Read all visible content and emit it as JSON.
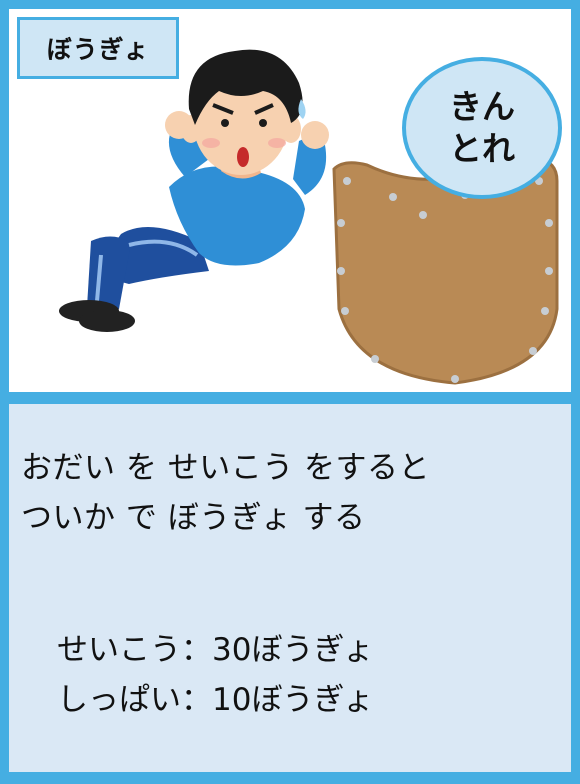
{
  "card": {
    "category_label": "ぼうぎょ",
    "skill_line1": "きん",
    "skill_line2": "とれ",
    "description_line1": "おだい を せいこう をすると",
    "description_line2": "ついか で ぼうぎょ する",
    "success_line": "せいこう：30ぼうぎょ",
    "failure_line": "しっぱい：10ぼうぎょ"
  },
  "colors": {
    "frame": "#45aee2",
    "label_fill": "#cfe6f5",
    "description_fill": "#dae8f5",
    "shield_leather": "#b98a55",
    "shirt": "#2f8fd6",
    "pants": "#1f4f9e"
  },
  "icons": [
    "sit-up-person-illustration",
    "leather-shield-icon"
  ]
}
